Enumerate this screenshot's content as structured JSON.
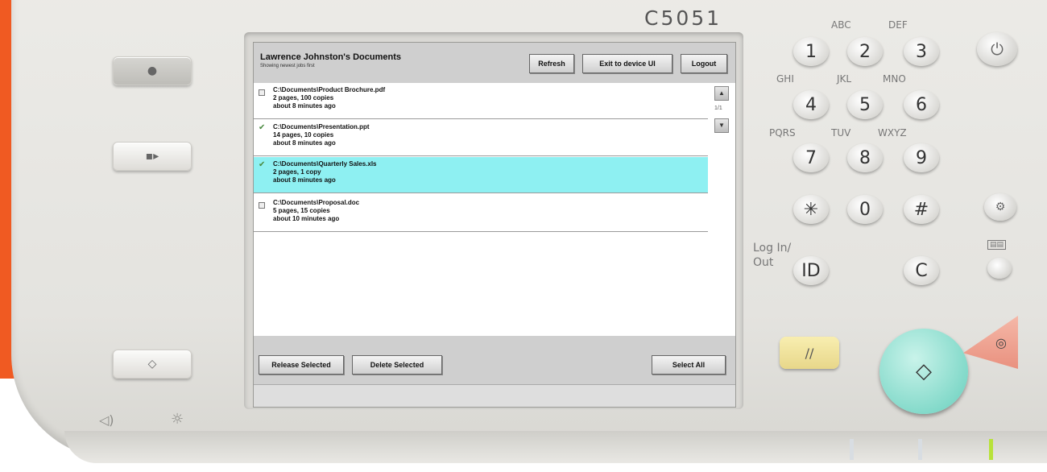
{
  "device": {
    "model": "C5051"
  },
  "screen": {
    "title": "Lawrence Johnston's Documents",
    "subtitle": "Showing newest jobs first",
    "toolbar": {
      "refresh_label": "Refresh",
      "exit_label": "Exit to device UI",
      "logout_label": "Logout"
    },
    "jobs": [
      {
        "path": "C:\\Documents\\Product Brochure.pdf",
        "details": "2 pages, 100 copies",
        "age": "about 8 minutes ago",
        "checked": false,
        "selected": false
      },
      {
        "path": "C:\\Documents\\Presentation.ppt",
        "details": "14 pages, 10 copies",
        "age": "about 8 minutes ago",
        "checked": true,
        "selected": false
      },
      {
        "path": "C:\\Documents\\Quarterly Sales.xls",
        "details": "2 pages, 1 copy",
        "age": "about 8 minutes ago",
        "checked": true,
        "selected": true
      },
      {
        "path": "C:\\Documents\\Proposal.doc",
        "details": "5 pages, 15 copies",
        "age": "about 10 minutes ago",
        "checked": false,
        "selected": false
      }
    ],
    "pager": "1/1",
    "footer": {
      "release_label": "Release Selected",
      "delete_label": "Delete Selected",
      "select_all_label": "Select All"
    },
    "colors": {
      "selected_row": "#8ef0f2",
      "check": "#4a8a40"
    }
  },
  "keypad": {
    "keys": [
      "1",
      "2",
      "3",
      "4",
      "5",
      "6",
      "7",
      "8",
      "9",
      "✳",
      "0",
      "#"
    ],
    "letters": [
      "ABC",
      "DEF",
      "GHI",
      "JKL",
      "MNO",
      "PQRS",
      "TUV",
      "WXYZ"
    ],
    "login_label_1": "Log In/",
    "login_label_2": "Out",
    "id_label": "ID",
    "clear_label": "C",
    "reset_icon": "//",
    "power_icon": "⏻",
    "start_icon": "◇",
    "stop_icon": "◎",
    "settings_icon": "⚙",
    "counter_label": "▤▤"
  },
  "icons": {
    "speaker": "speaker-icon",
    "brightness": "brightness-icon"
  }
}
